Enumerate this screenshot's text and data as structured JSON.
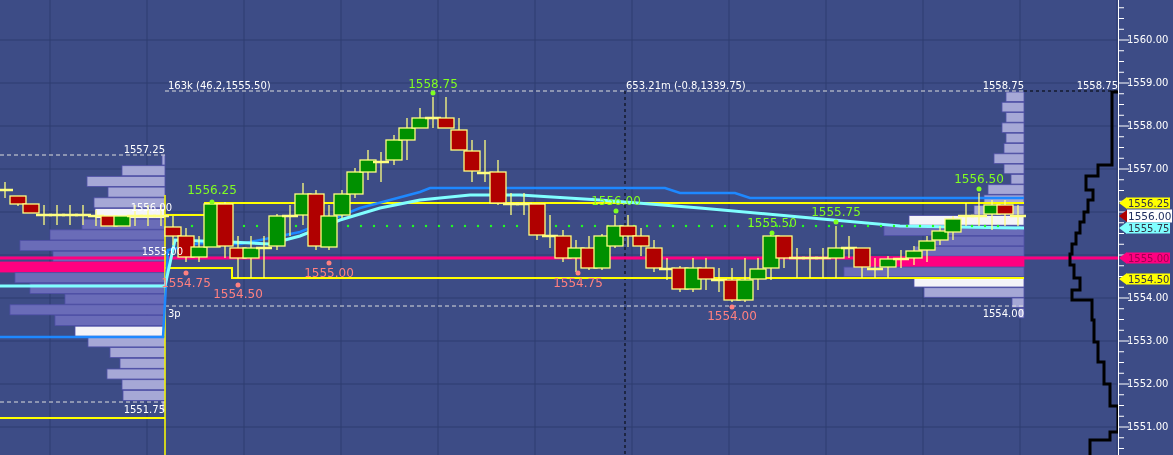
{
  "price_axis": {
    "labels": [
      "1560.00",
      "1559.00",
      "1558.00",
      "1557.00",
      "1554.00",
      "1553.00",
      "1552.00",
      "1551.00"
    ]
  },
  "price_tags": [
    {
      "text": "1556.25",
      "kind": "level",
      "color": "#ffff00"
    },
    {
      "text": "1556.00",
      "kind": "current",
      "color": "#ffffff"
    },
    {
      "text": "1555.75",
      "kind": "level",
      "color": "#80ffff"
    },
    {
      "text": "1555.00",
      "kind": "level",
      "color": "#ff0080"
    },
    {
      "text": "1554.50",
      "kind": "level",
      "color": "#ffff00"
    }
  ],
  "info_labels": [
    "163k (46.2,1555.50)",
    "653.21m (-0.8,1339.75)",
    "1558.75",
    "1558.75",
    "1557.25",
    "1556.00",
    "1555.00",
    "3p",
    "1551.75",
    "1554.00"
  ],
  "swing_highs": [
    "1556.25",
    "1558.75",
    "1556.00",
    "1555.50",
    "1555.75",
    "1556.50"
  ],
  "swing_lows": [
    "1554.75",
    "1554.50",
    "1555.00",
    "1554.75",
    "1554.00"
  ]
}
